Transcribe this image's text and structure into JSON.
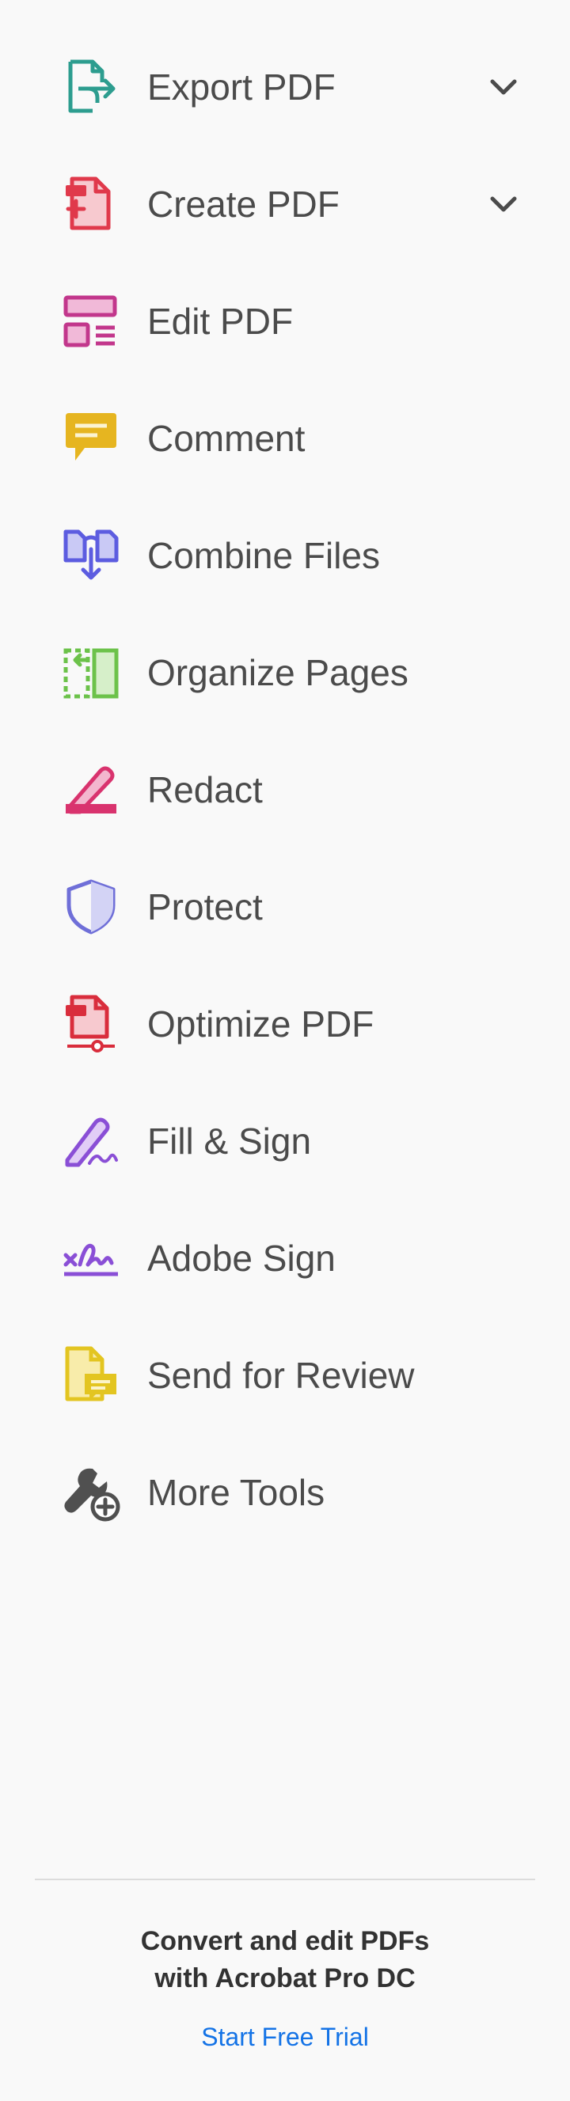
{
  "tools": [
    {
      "id": "export-pdf",
      "label": "Export PDF",
      "icon": "export-pdf-icon",
      "has_dropdown": true
    },
    {
      "id": "create-pdf",
      "label": "Create PDF",
      "icon": "create-pdf-icon",
      "has_dropdown": true
    },
    {
      "id": "edit-pdf",
      "label": "Edit PDF",
      "icon": "edit-pdf-icon",
      "has_dropdown": false
    },
    {
      "id": "comment",
      "label": "Comment",
      "icon": "comment-icon",
      "has_dropdown": false
    },
    {
      "id": "combine-files",
      "label": "Combine Files",
      "icon": "combine-files-icon",
      "has_dropdown": false
    },
    {
      "id": "organize-pages",
      "label": "Organize Pages",
      "icon": "organize-pages-icon",
      "has_dropdown": false
    },
    {
      "id": "redact",
      "label": "Redact",
      "icon": "redact-icon",
      "has_dropdown": false
    },
    {
      "id": "protect",
      "label": "Protect",
      "icon": "protect-icon",
      "has_dropdown": false
    },
    {
      "id": "optimize-pdf",
      "label": "Optimize PDF",
      "icon": "optimize-pdf-icon",
      "has_dropdown": false
    },
    {
      "id": "fill-sign",
      "label": "Fill & Sign",
      "icon": "fill-sign-icon",
      "has_dropdown": false
    },
    {
      "id": "adobe-sign",
      "label": "Adobe Sign",
      "icon": "adobe-sign-icon",
      "has_dropdown": false
    },
    {
      "id": "send-for-review",
      "label": "Send for Review",
      "icon": "send-for-review-icon",
      "has_dropdown": false
    },
    {
      "id": "more-tools",
      "label": "More Tools",
      "icon": "more-tools-icon",
      "has_dropdown": false
    }
  ],
  "promo": {
    "line1": "Convert and edit PDFs",
    "line2": "with Acrobat Pro DC",
    "cta": "Start Free Trial"
  },
  "colors": {
    "export": "#2d9d8f",
    "create": "#e0394b",
    "edit": "#c2378c",
    "comment": "#e6b520",
    "combine": "#5c5ce0",
    "organize": "#6cc24a",
    "redact": "#d9336e",
    "protect": "#6f6fd8",
    "optimize": "#d92d3c",
    "fillsign": "#8a4fd6",
    "adobesign": "#8a4fd6",
    "review": "#e3c521",
    "more": "#505050",
    "link": "#1473e6"
  }
}
